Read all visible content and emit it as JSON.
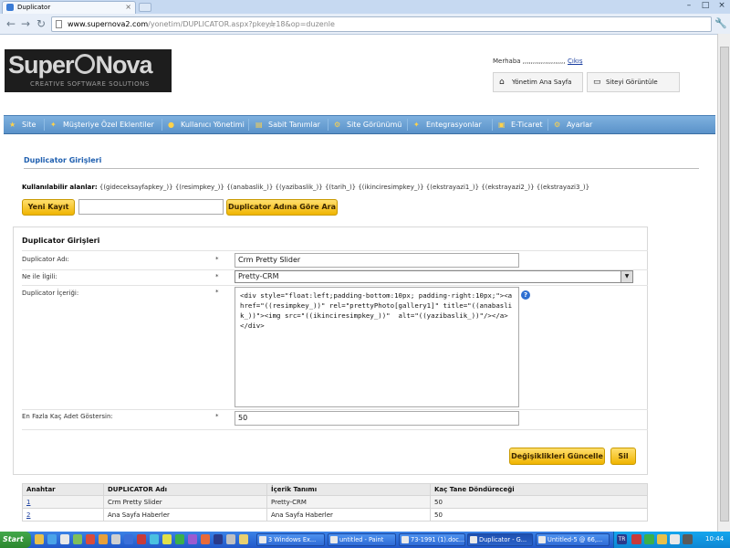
{
  "browser": {
    "tab_title": "Duplicator",
    "url_host": "www.supernova2.com",
    "url_path": "/yonetim/DUPLICATOR.aspx?pkey=18&op=duzenle"
  },
  "header": {
    "logo_main": "Super",
    "logo_main2": "Nova",
    "logo_tagline": "CREATIVE SOFTWARE SOLUTIONS",
    "greeting": "Merhaba ,,,,,,,,,,,,,,,,,,,,,",
    "logout": "Çıkış",
    "admin_home": "Yönetim Ana Sayfa",
    "view_site": "Siteyi Görüntüle"
  },
  "menu": [
    {
      "label": "Site",
      "icon": "star-icon"
    },
    {
      "label": "Müşteriye Özel Eklentiler",
      "icon": "plugin-icon"
    },
    {
      "label": "Kullanıcı Yönetimi",
      "icon": "user-icon"
    },
    {
      "label": "Sabit Tanımlar",
      "icon": "page-icon"
    },
    {
      "label": "Site Görünümü",
      "icon": "gear-icon"
    },
    {
      "label": "Entegrasyonlar",
      "icon": "plugin-icon"
    },
    {
      "label": "E-Ticaret",
      "icon": "cart-icon"
    },
    {
      "label": "Ayarlar",
      "icon": "gear-icon"
    }
  ],
  "page": {
    "title": "Duplicator Girişleri",
    "fields_label": "Kullanılabilir alanlar:",
    "fields_value": "{(gideceksayfapkey_)} {(resimpkey_)} {(anabaslik_)} {(yazibaslik_)} {(tarih_)} {(ikinciresimpkey_)} {(ekstrayazi1_)} {(ekstrayazi2_)} {(ekstrayazi3_)}",
    "new_record": "Yeni Kayıt",
    "search_value": "",
    "search_button": "Duplicator Adına Göre Ara"
  },
  "form": {
    "title": "Duplicator Girişleri",
    "name_label": "Duplicator Adı:",
    "name_value": "Crm Pretty Slider",
    "related_label": "Ne ile İlgili:",
    "related_value": "Pretty-CRM",
    "content_label": "Duplicator İçeriği:",
    "content_value": "<div style=\"float:left;padding-bottom:10px; padding-right:10px;\"><a href=\"((resimpkey_))\" rel=\"prettyPhoto[gallery1]\" title=\"((anabaslik_))\"><img src=\"((ikinciresimpkey_))\"  alt=\"((yazibaslik_))\"/></a></div>",
    "max_label": "En Fazla Kaç Adet Göstersin:",
    "max_value": "50",
    "required_mark": "*",
    "save_button": "Değişiklikleri Güncelle",
    "delete_button": "Sil",
    "help": "?"
  },
  "table": {
    "headers": [
      "Anahtar",
      "DUPLICATOR Adı",
      "İçerik Tanımı",
      "Kaç Tane Döndüreceği"
    ],
    "rows": [
      [
        "1",
        "Crm Pretty Slider",
        "Pretty-CRM",
        "50"
      ],
      [
        "2",
        "Ana Sayfa Haberler",
        "Ana Sayfa Haberler",
        "50"
      ]
    ]
  },
  "taskbar": {
    "start": "Start",
    "items": [
      "3 Windows Ex...",
      "untitled - Paint",
      "73-1991 (1).doc...",
      "Duplicator - G...",
      "Untitled-5 @ 66,..."
    ],
    "lang": "TR",
    "clock": "10:44"
  },
  "colors": {
    "menu_bar": "#5a92c9",
    "button_yellow": "#f0b400",
    "title_blue": "#2060b0",
    "taskbar": "#2157c9"
  }
}
